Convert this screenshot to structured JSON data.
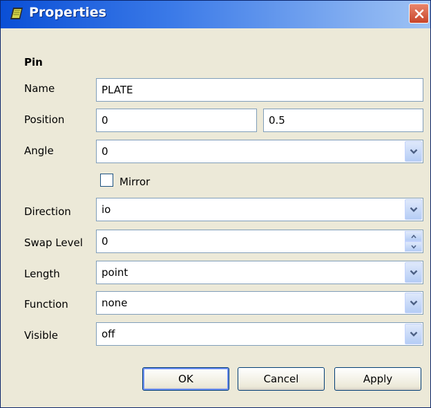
{
  "window": {
    "title": "Properties",
    "close_icon": "close-icon"
  },
  "section": {
    "title": "Pin"
  },
  "fields": {
    "name": {
      "label": "Name",
      "value": "PLATE"
    },
    "position": {
      "label": "Position",
      "x": "0",
      "y": "0.5"
    },
    "angle": {
      "label": "Angle",
      "value": "0"
    },
    "mirror": {
      "label": "Mirror",
      "checked": false
    },
    "direction": {
      "label": "Direction",
      "value": "io"
    },
    "swap_level": {
      "label": "Swap Level",
      "value": "0"
    },
    "length": {
      "label": "Length",
      "value": "point"
    },
    "function": {
      "label": "Function",
      "value": "none"
    },
    "visible": {
      "label": "Visible",
      "value": "off"
    }
  },
  "buttons": {
    "ok": "OK",
    "cancel": "Cancel",
    "apply": "Apply"
  },
  "colors": {
    "titlebar": "#0a4fd6",
    "close": "#c8452a",
    "dialog_bg": "#ece9d8",
    "field_border": "#7f9db9"
  }
}
